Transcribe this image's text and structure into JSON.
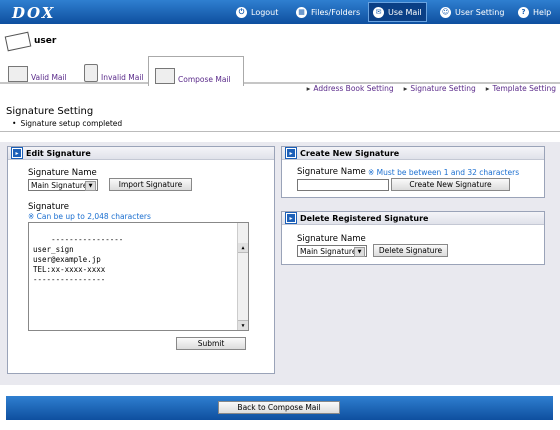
{
  "app": {
    "logo": "DOX"
  },
  "nav": {
    "logout": "Logout",
    "files": "Files/Folders",
    "usemail": "Use Mail",
    "usersetting": "User Setting",
    "help": "Help"
  },
  "user": {
    "name": "user"
  },
  "tabs": {
    "valid": "Valid Mail",
    "invalid": "Invalid Mail",
    "compose": "Compose Mail"
  },
  "links": {
    "address_book": "Address Book Setting",
    "signature": "Signature Setting",
    "template": "Template Setting"
  },
  "page": {
    "title": "Signature Setting",
    "status": "Signature setup completed"
  },
  "edit": {
    "title": "Edit Signature",
    "name_label": "Signature Name",
    "selected": "Main Signature",
    "import_button": "Import Signature",
    "sig_label": "Signature",
    "sig_note": "※ Can be up to 2,048 characters",
    "sig_text": "----------------\nuser_sign\nuser@example.jp\nTEL:xx-xxxx-xxxx\n----------------",
    "submit": "Submit"
  },
  "create": {
    "title": "Create New Signature",
    "name_label": "Signature Name",
    "note": "※ Must be between 1 and 32 characters",
    "button": "Create New Signature"
  },
  "delete": {
    "title": "Delete Registered Signature",
    "name_label": "Signature Name",
    "selected": "Main Signature",
    "button": "Delete Signature"
  },
  "footer": {
    "back": "Back to Compose Mail"
  },
  "colors": {
    "header_blue": "#1a63b8",
    "link_purple": "#5a2a8a",
    "note_blue": "#1b6fd0"
  }
}
